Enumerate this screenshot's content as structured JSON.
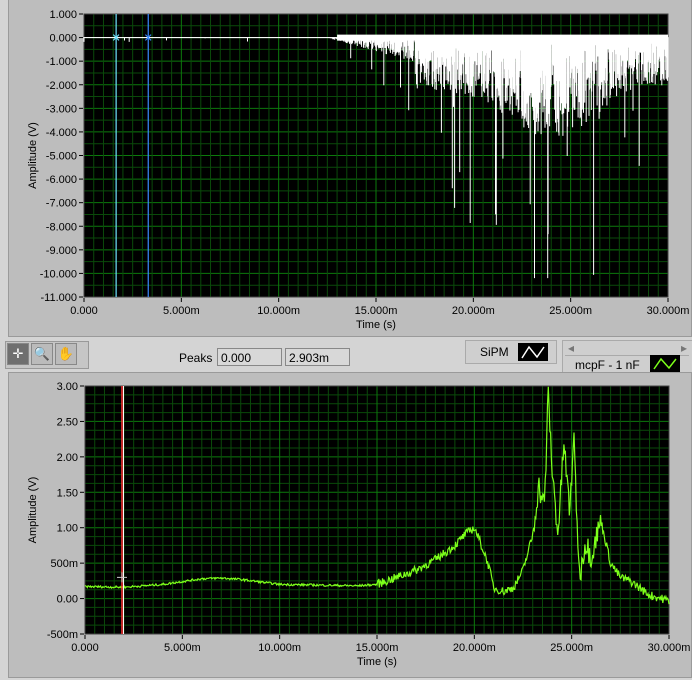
{
  "top_graph": {
    "y_label": "Amplitude (V)",
    "x_label": "Time (s)",
    "y_ticks": [
      "1.000",
      "0.000",
      "-1.000",
      "-2.000",
      "-3.000",
      "-4.000",
      "-5.000",
      "-6.000",
      "-7.000",
      "-8.000",
      "-9.000",
      "-10.000",
      "-11.000"
    ],
    "y_range": [
      -11,
      1
    ],
    "x_ticks": [
      "0.000",
      "5.000m",
      "10.000m",
      "15.000m",
      "20.000m",
      "25.000m",
      "30.000m"
    ],
    "x_range_ms": [
      0,
      30
    ],
    "trace_color": "#ffffff",
    "cursors": [
      {
        "t_ms": 1.65,
        "color": "#6fe3ff"
      },
      {
        "t_ms": 3.3,
        "color": "#3a8bff"
      }
    ]
  },
  "toolbar": {
    "tools": [
      "cursor-move-tool",
      "zoom-tool",
      "pan-tool"
    ]
  },
  "peaks": {
    "label": "Peaks",
    "value1": "0.000",
    "value2": "2.903m"
  },
  "legend_top": {
    "label": "SiPM"
  },
  "legend_bottom": {
    "label": "mcpF - 1 nF"
  },
  "bottom_graph": {
    "y_label": "Amplitude (V)",
    "x_label": "Time (s)",
    "y_ticks": [
      "3.00",
      "2.50",
      "2.00",
      "1.50",
      "1.00",
      "500m",
      "0.00",
      "-500m"
    ],
    "y_range": [
      -0.5,
      3
    ],
    "x_ticks": [
      "0.000",
      "5.000m",
      "10.000m",
      "15.000m",
      "20.000m",
      "25.000m",
      "30.000m"
    ],
    "x_range_ms": [
      0,
      30
    ],
    "trace_color": "#7cff1a",
    "cursor": {
      "t_ms": 1.9,
      "color": "#ff3030"
    },
    "trace": [
      [
        0,
        0.17
      ],
      [
        2,
        0.16
      ],
      [
        4,
        0.2
      ],
      [
        6,
        0.28
      ],
      [
        7,
        0.29
      ],
      [
        8,
        0.27
      ],
      [
        10,
        0.2
      ],
      [
        12,
        0.19
      ],
      [
        14,
        0.18
      ],
      [
        15,
        0.2
      ],
      [
        16,
        0.3
      ],
      [
        17,
        0.4
      ],
      [
        18,
        0.55
      ],
      [
        19,
        0.75
      ],
      [
        19.5,
        0.9
      ],
      [
        20,
        1.0
      ],
      [
        20.3,
        0.8
      ],
      [
        20.7,
        0.5
      ],
      [
        21,
        0.15
      ],
      [
        21.5,
        0.1
      ],
      [
        22,
        0.15
      ],
      [
        22.5,
        0.4
      ],
      [
        23,
        0.9
      ],
      [
        23.3,
        1.6
      ],
      [
        23.6,
        1.3
      ],
      [
        23.8,
        2.9
      ],
      [
        24,
        1.8
      ],
      [
        24.3,
        0.9
      ],
      [
        24.6,
        2.2
      ],
      [
        24.9,
        1.2
      ],
      [
        25.1,
        2.3
      ],
      [
        25.4,
        0.3
      ],
      [
        25.7,
        0.8
      ],
      [
        26,
        0.6
      ],
      [
        26.5,
        1.1
      ],
      [
        27,
        0.5
      ],
      [
        27.5,
        0.3
      ],
      [
        28,
        0.25
      ],
      [
        29,
        0.05
      ],
      [
        30,
        -0.03
      ]
    ]
  }
}
